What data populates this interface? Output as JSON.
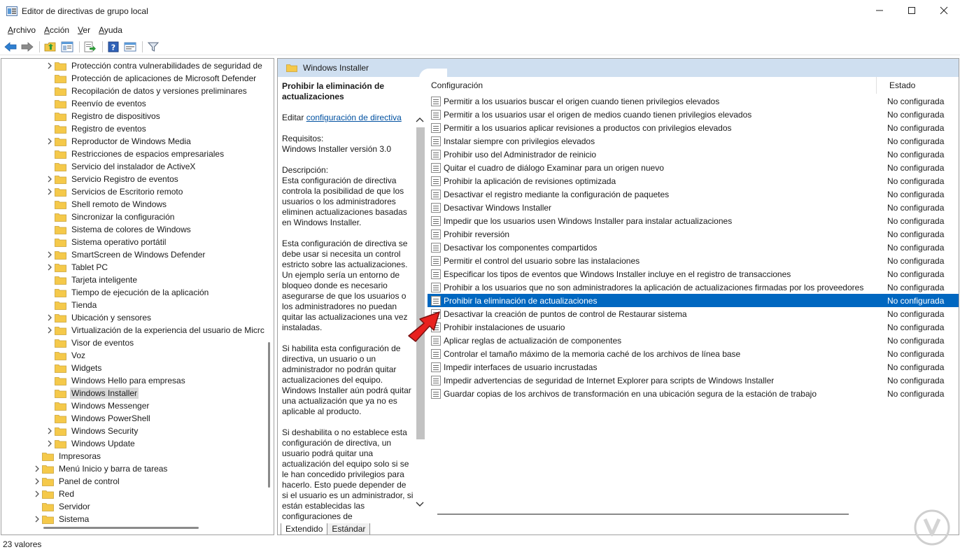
{
  "window": {
    "title": "Editor de directivas de grupo local"
  },
  "menu": [
    {
      "label": "Archivo",
      "u": "A",
      "rest": "rchivo"
    },
    {
      "label": "Acción",
      "u": "A",
      "rest": "cción"
    },
    {
      "label": "Ver",
      "u": "V",
      "rest": "er"
    },
    {
      "label": "Ayuda",
      "u": "A",
      "rest": "yuda"
    }
  ],
  "tree": [
    {
      "label": "Protección contra vulnerabilidades de seguridad de",
      "expander": true,
      "indent": 2
    },
    {
      "label": "Protección de aplicaciones de Microsoft Defender",
      "expander": false,
      "indent": 2
    },
    {
      "label": "Recopilación de datos y versiones preliminares",
      "expander": false,
      "indent": 2
    },
    {
      "label": "Reenvío de eventos",
      "expander": false,
      "indent": 2
    },
    {
      "label": "Registro de dispositivos",
      "expander": false,
      "indent": 2
    },
    {
      "label": "Registro de eventos",
      "expander": false,
      "indent": 2
    },
    {
      "label": "Reproductor de Windows Media",
      "expander": true,
      "indent": 2
    },
    {
      "label": "Restricciones de espacios empresariales",
      "expander": false,
      "indent": 2
    },
    {
      "label": "Servicio del instalador de ActiveX",
      "expander": false,
      "indent": 2
    },
    {
      "label": "Servicio Registro de eventos",
      "expander": true,
      "indent": 2
    },
    {
      "label": "Servicios de Escritorio remoto",
      "expander": true,
      "indent": 2
    },
    {
      "label": "Shell remoto de Windows",
      "expander": false,
      "indent": 2
    },
    {
      "label": "Sincronizar la configuración",
      "expander": false,
      "indent": 2
    },
    {
      "label": "Sistema de colores de Windows",
      "expander": false,
      "indent": 2
    },
    {
      "label": "Sistema operativo portátil",
      "expander": false,
      "indent": 2
    },
    {
      "label": "SmartScreen de Windows Defender",
      "expander": true,
      "indent": 2
    },
    {
      "label": "Tablet PC",
      "expander": true,
      "indent": 2
    },
    {
      "label": "Tarjeta inteligente",
      "expander": false,
      "indent": 2
    },
    {
      "label": "Tiempo de ejecución de la aplicación",
      "expander": false,
      "indent": 2
    },
    {
      "label": "Tienda",
      "expander": false,
      "indent": 2
    },
    {
      "label": "Ubicación y sensores",
      "expander": true,
      "indent": 2
    },
    {
      "label": "Virtualización de la experiencia del usuario de Micrc",
      "expander": true,
      "indent": 2
    },
    {
      "label": "Visor de eventos",
      "expander": false,
      "indent": 2
    },
    {
      "label": "Voz",
      "expander": false,
      "indent": 2
    },
    {
      "label": "Widgets",
      "expander": false,
      "indent": 2
    },
    {
      "label": "Windows Hello para empresas",
      "expander": false,
      "indent": 2
    },
    {
      "label": "Windows Installer",
      "expander": false,
      "indent": 2,
      "selected": true
    },
    {
      "label": "Windows Messenger",
      "expander": false,
      "indent": 2
    },
    {
      "label": "Windows PowerShell",
      "expander": false,
      "indent": 2
    },
    {
      "label": "Windows Security",
      "expander": true,
      "indent": 2
    },
    {
      "label": "Windows Update",
      "expander": true,
      "indent": 2
    },
    {
      "label": "Impresoras",
      "expander": false,
      "indent": 1
    },
    {
      "label": "Menú Inicio y barra de tareas",
      "expander": true,
      "indent": 1
    },
    {
      "label": "Panel de control",
      "expander": true,
      "indent": 1
    },
    {
      "label": "Red",
      "expander": true,
      "indent": 1
    },
    {
      "label": "Servidor",
      "expander": false,
      "indent": 1
    },
    {
      "label": "Sistema",
      "expander": true,
      "indent": 1
    }
  ],
  "section": {
    "title": "Windows Installer"
  },
  "description": {
    "title": "Prohibir la eliminación de actualizaciones",
    "edit_prefix": "Editar",
    "edit_link": "configuración de directiva",
    "req_label": "Requisitos:",
    "req_value": "Windows Installer versión 3.0",
    "desc_label": "Descripción:",
    "p1": "Esta configuración de directiva controla la posibilidad de que los usuarios o los administradores eliminen actualizaciones basadas en Windows Installer.",
    "p2": "Esta configuración de directiva se debe usar si necesita un control estricto sobre las actualizaciones. Un ejemplo sería un entorno de bloqueo donde es necesario asegurarse de que los usuarios o los administradores no puedan quitar las actualizaciones una vez instaladas.",
    "p3": "Si habilita esta configuración de directiva, un usuario o un administrador no podrán quitar actualizaciones del equipo. Windows Installer aún podrá quitar una actualización que ya no es aplicable al producto.",
    "p4": "Si deshabilita o no establece esta configuración de directiva, un usuario podrá quitar una actualización del equipo solo si se le han concedido privilegios para hacerlo. Esto puede depender de si el usuario es un administrador, si están establecidas las configuraciones de"
  },
  "tabs": [
    "Extendido",
    "Estándar"
  ],
  "list": {
    "col_config": "Configuración",
    "col_state": "Estado",
    "rows": [
      {
        "name": "Permitir a los usuarios buscar el origen cuando tienen privilegios elevados",
        "state": "No configurada"
      },
      {
        "name": "Permitir a los usuarios usar el origen de medios cuando tienen privilegios elevados",
        "state": "No configurada"
      },
      {
        "name": "Permitir a los usuarios aplicar revisiones a productos con privilegios elevados",
        "state": "No configurada"
      },
      {
        "name": "Instalar siempre con privilegios elevados",
        "state": "No configurada"
      },
      {
        "name": "Prohibir uso del Administrador de reinicio",
        "state": "No configurada"
      },
      {
        "name": "Quitar el cuadro de diálogo Examinar para un origen nuevo",
        "state": "No configurada"
      },
      {
        "name": "Prohibir la aplicación de revisiones optimizada",
        "state": "No configurada"
      },
      {
        "name": "Desactivar el registro mediante la configuración de paquetes",
        "state": "No configurada"
      },
      {
        "name": "Desactivar Windows Installer",
        "state": "No configurada"
      },
      {
        "name": "Impedir que los usuarios usen Windows Installer para instalar actualizaciones",
        "state": "No configurada"
      },
      {
        "name": "Prohibir reversión",
        "state": "No configurada"
      },
      {
        "name": "Desactivar los componentes compartidos",
        "state": "No configurada"
      },
      {
        "name": "Permitir el control del usuario sobre las instalaciones",
        "state": "No configurada"
      },
      {
        "name": "Especificar los tipos de eventos que Windows Installer incluye en el registro de transacciones",
        "state": "No configurada"
      },
      {
        "name": "Prohibir a los usuarios que no son administradores la aplicación de actualizaciones firmadas por los proveedores",
        "state": "No configurada"
      },
      {
        "name": "Prohibir la eliminación de actualizaciones",
        "state": "No configurada",
        "selected": true
      },
      {
        "name": "Desactivar la creación de puntos de control de Restaurar sistema",
        "state": "No configurada"
      },
      {
        "name": "Prohibir instalaciones de usuario",
        "state": "No configurada"
      },
      {
        "name": "Aplicar reglas de actualización de componentes",
        "state": "No configurada"
      },
      {
        "name": "Controlar el tamaño máximo de la memoria caché de los archivos de línea base",
        "state": "No configurada"
      },
      {
        "name": "Impedir interfaces de usuario incrustadas",
        "state": "No configurada"
      },
      {
        "name": "Impedir advertencias de seguridad de Internet Explorer para scripts de Windows Installer",
        "state": "No configurada"
      },
      {
        "name": "Guardar copias de los archivos de transformación en una ubicación segura de la estación de trabajo",
        "state": "No configurada"
      }
    ]
  },
  "status": {
    "text": "23 valores"
  },
  "colors": {
    "selection": "#0067c0",
    "header": "#cfdff0",
    "folder": "#f5c94a",
    "arrow": "#e8211e"
  }
}
